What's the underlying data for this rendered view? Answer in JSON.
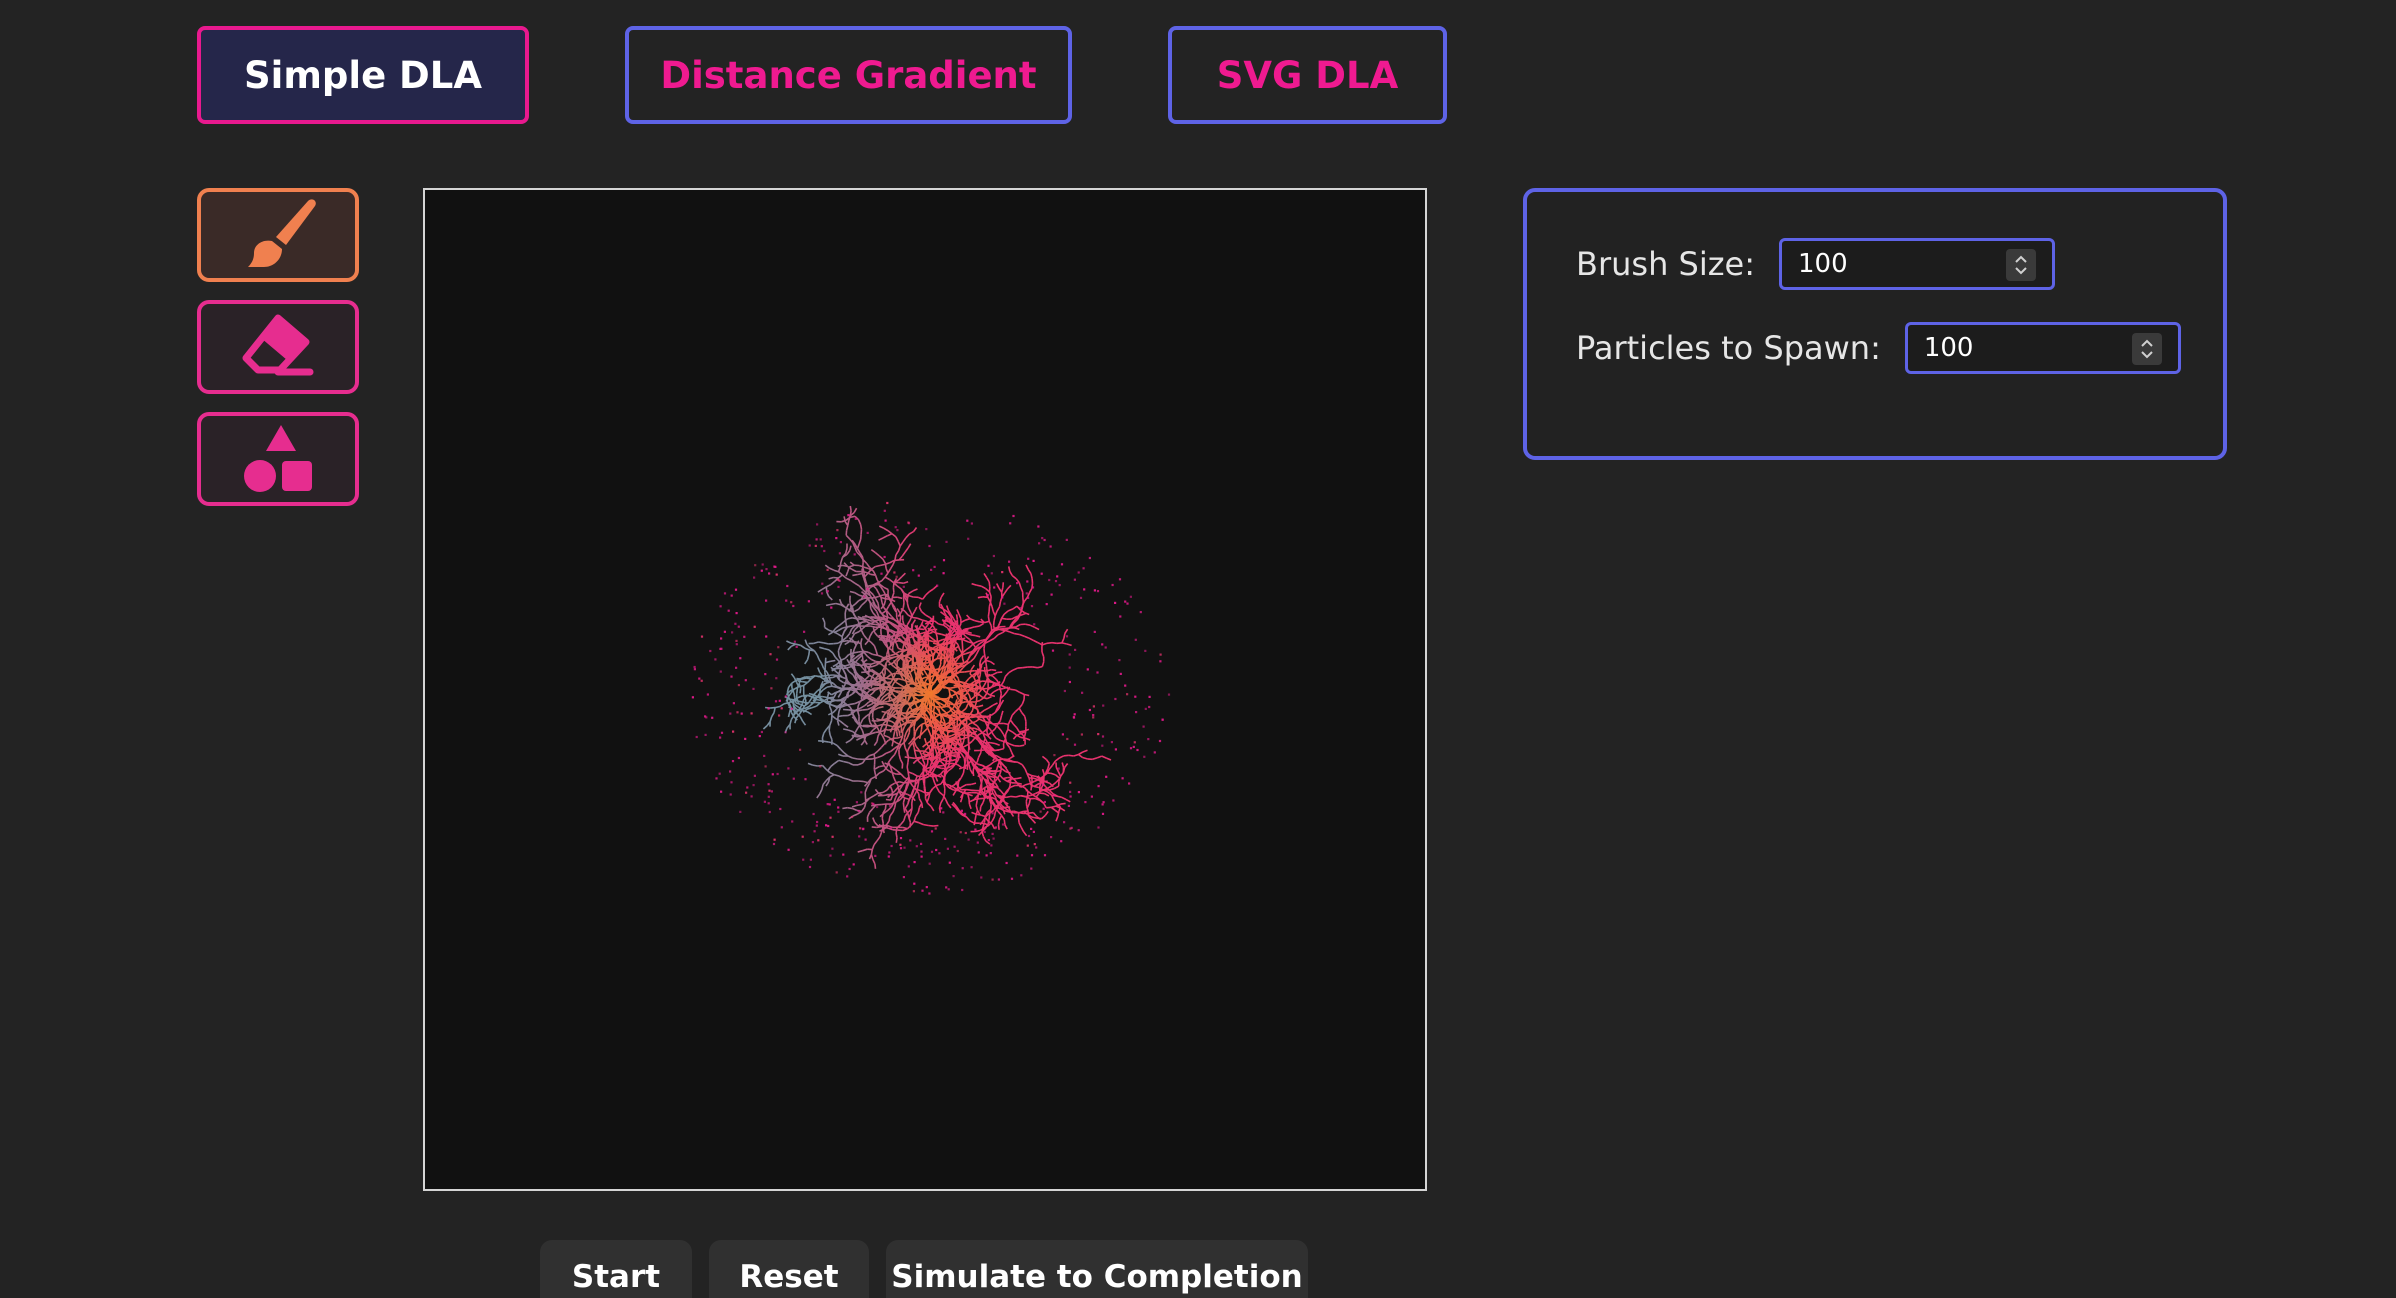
{
  "tabs": [
    {
      "label": "Simple DLA",
      "active": true
    },
    {
      "label": "Distance Gradient",
      "active": false
    },
    {
      "label": "SVG DLA",
      "active": false
    }
  ],
  "tools": [
    {
      "icon": "paintbrush-icon",
      "active": true
    },
    {
      "icon": "eraser-icon",
      "active": false
    },
    {
      "icon": "shapes-icon",
      "active": false
    }
  ],
  "settings": {
    "brush_size_label": "Brush Size:",
    "brush_size_value": "100",
    "particles_label": "Particles to Spawn:",
    "particles_value": "100"
  },
  "controls": {
    "start_label": "Start",
    "reset_label": "Reset",
    "simulate_label": "Simulate to Completion"
  },
  "colors": {
    "background": "#232323",
    "canvas": "#111111",
    "accent_pink": "#e8198e",
    "accent_blue": "#5e63e6",
    "accent_orange": "#f0804f",
    "cluster_core": "#f07a2a",
    "cluster_mid": "#e8336e",
    "cluster_edge": "#5fa0a8"
  }
}
